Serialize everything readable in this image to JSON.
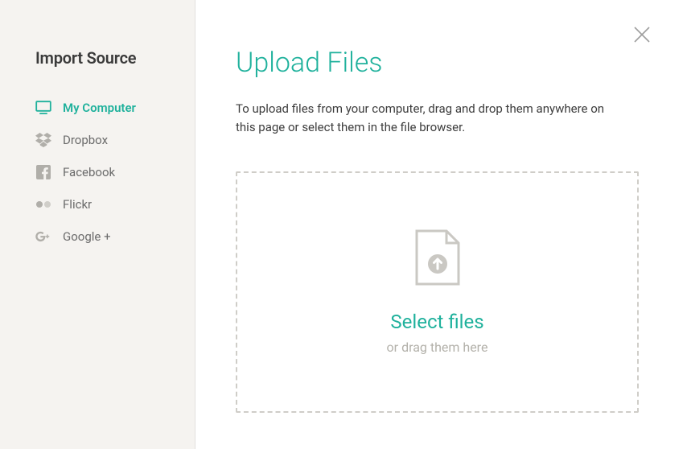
{
  "sidebar": {
    "title": "Import Source",
    "items": [
      {
        "label": "My Computer",
        "icon": "computer",
        "active": true
      },
      {
        "label": "Dropbox",
        "icon": "dropbox",
        "active": false
      },
      {
        "label": "Facebook",
        "icon": "facebook",
        "active": false
      },
      {
        "label": "Flickr",
        "icon": "flickr",
        "active": false
      },
      {
        "label": "Google +",
        "icon": "googleplus",
        "active": false
      }
    ]
  },
  "main": {
    "title": "Upload Files",
    "description": "To upload files from your computer, drag and drop them anywhere on this page or select them in the file browser.",
    "select_label": "Select files",
    "drag_hint": "or drag them here"
  },
  "colors": {
    "accent": "#1fb19c",
    "muted": "#b3b1aa",
    "sidebar_bg": "#f5f3f0"
  }
}
